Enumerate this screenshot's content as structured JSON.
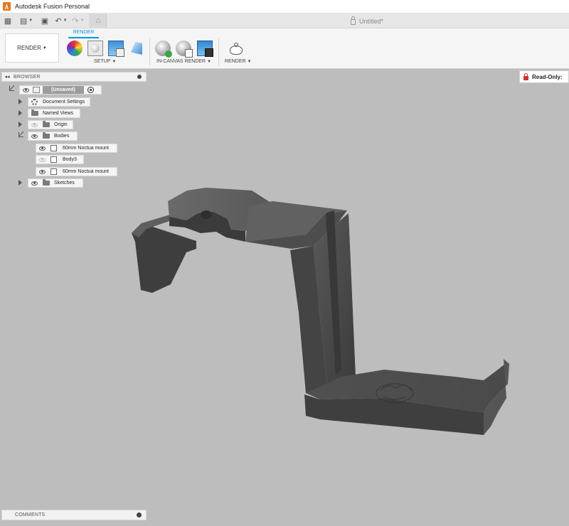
{
  "window": {
    "title": "Autodesk Fusion Personal"
  },
  "document_tab": {
    "title": "Untitled*"
  },
  "workspace": {
    "label": "RENDER"
  },
  "toolbar": {
    "active_tab": "RENDER",
    "groups": {
      "setup": "SETUP",
      "in_canvas_render": "IN-CANVAS RENDER",
      "render": "RENDER"
    }
  },
  "browser": {
    "title": "BROWSER",
    "root": {
      "label": "(Unsaved)"
    },
    "items": {
      "document_settings": "Document Settings",
      "named_views": "Named Views",
      "origin": "Origin",
      "bodies": "Bodies",
      "sketches": "Sketches"
    },
    "bodies": [
      "60mm Noctua mount",
      "Body3",
      "60mm Noctua mount"
    ]
  },
  "status": {
    "read_only": "Read-Only:"
  },
  "comments": {
    "title": "COMMENTS"
  },
  "colors": {
    "accent": "#0696d7",
    "viewport": "#bdbdbd",
    "lock": "#d32f2f",
    "model": "#4a4a4a"
  }
}
